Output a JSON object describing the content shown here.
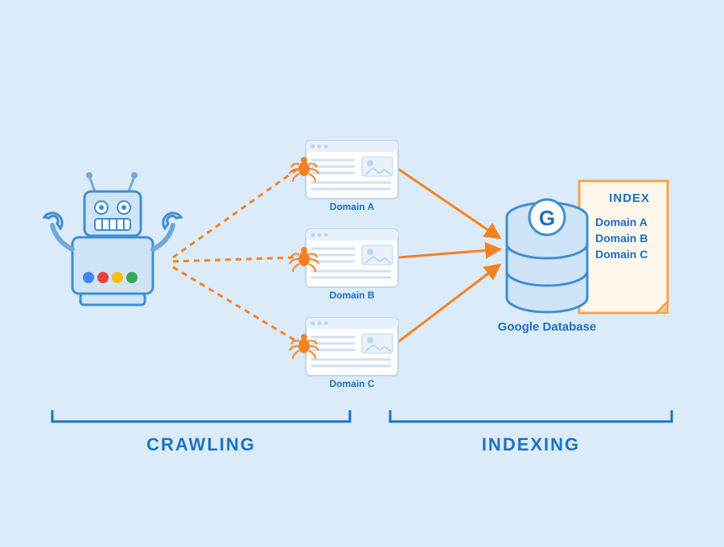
{
  "section_left": "CRAWLING",
  "section_right": "INDEXING",
  "domains": [
    "Domain A",
    "Domain B",
    "Domain C"
  ],
  "database_label": "Google Database",
  "index": {
    "title": "INDEX",
    "entries": [
      "Domain A",
      "Domain B",
      "Domain C"
    ]
  },
  "robot_letter": "G",
  "colors": {
    "blue": "#1b6fc0",
    "blue_stroke": "#3f8ed2",
    "light": "#cfe4f7",
    "orange": "#f58220",
    "bg": "#dcebf9",
    "paper": "#fff3e0"
  }
}
